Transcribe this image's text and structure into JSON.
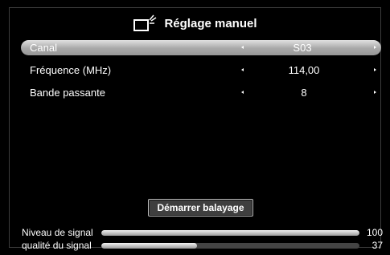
{
  "header": {
    "title": "Réglage manuel",
    "icon": "tv-antenna-icon"
  },
  "settings": [
    {
      "label": "Canal",
      "value": "S03",
      "selected": true
    },
    {
      "label": "Fréquence (MHz)",
      "value": "114,00",
      "selected": false
    },
    {
      "label": "Bande passante",
      "value": "8",
      "selected": false
    }
  ],
  "scan_button": {
    "label": "Démarrer balayage"
  },
  "signal": {
    "level": {
      "label": "Niveau de signal",
      "value": "100",
      "percent": 100
    },
    "quality": {
      "label": "qualité du signal",
      "value": "37",
      "percent": 37
    }
  },
  "colors": {
    "selection": "#c8c8c8",
    "background": "#000000",
    "bar_track": "#444444"
  }
}
